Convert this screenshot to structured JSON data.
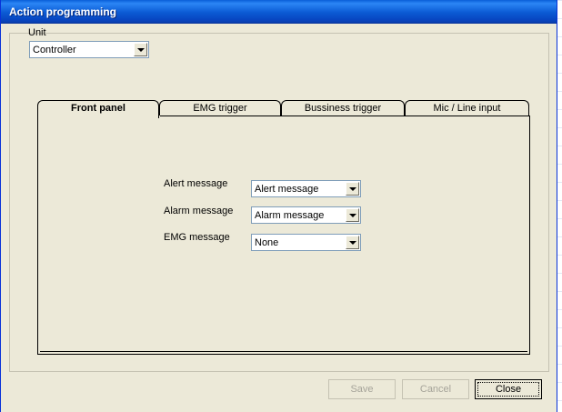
{
  "window": {
    "title": "Action programming"
  },
  "unit": {
    "label": "Unit",
    "selected": "Controller"
  },
  "tabs": [
    {
      "label": "Front panel",
      "active": true
    },
    {
      "label": "EMG trigger",
      "active": false
    },
    {
      "label": "Bussiness trigger",
      "active": false
    },
    {
      "label": "Mic / Line input",
      "active": false
    }
  ],
  "fields": {
    "alert": {
      "label": "Alert message",
      "selected": "Alert message"
    },
    "alarm": {
      "label": "Alarm message",
      "selected": "Alarm message"
    },
    "emg": {
      "label": "EMG message",
      "selected": "None"
    }
  },
  "buttons": {
    "save": "Save",
    "cancel": "Cancel",
    "close": "Close"
  },
  "colors": {
    "titlebar": "#0a5fd8",
    "window_bg": "#ece9d8",
    "disabled_text": "#a6a49a"
  }
}
